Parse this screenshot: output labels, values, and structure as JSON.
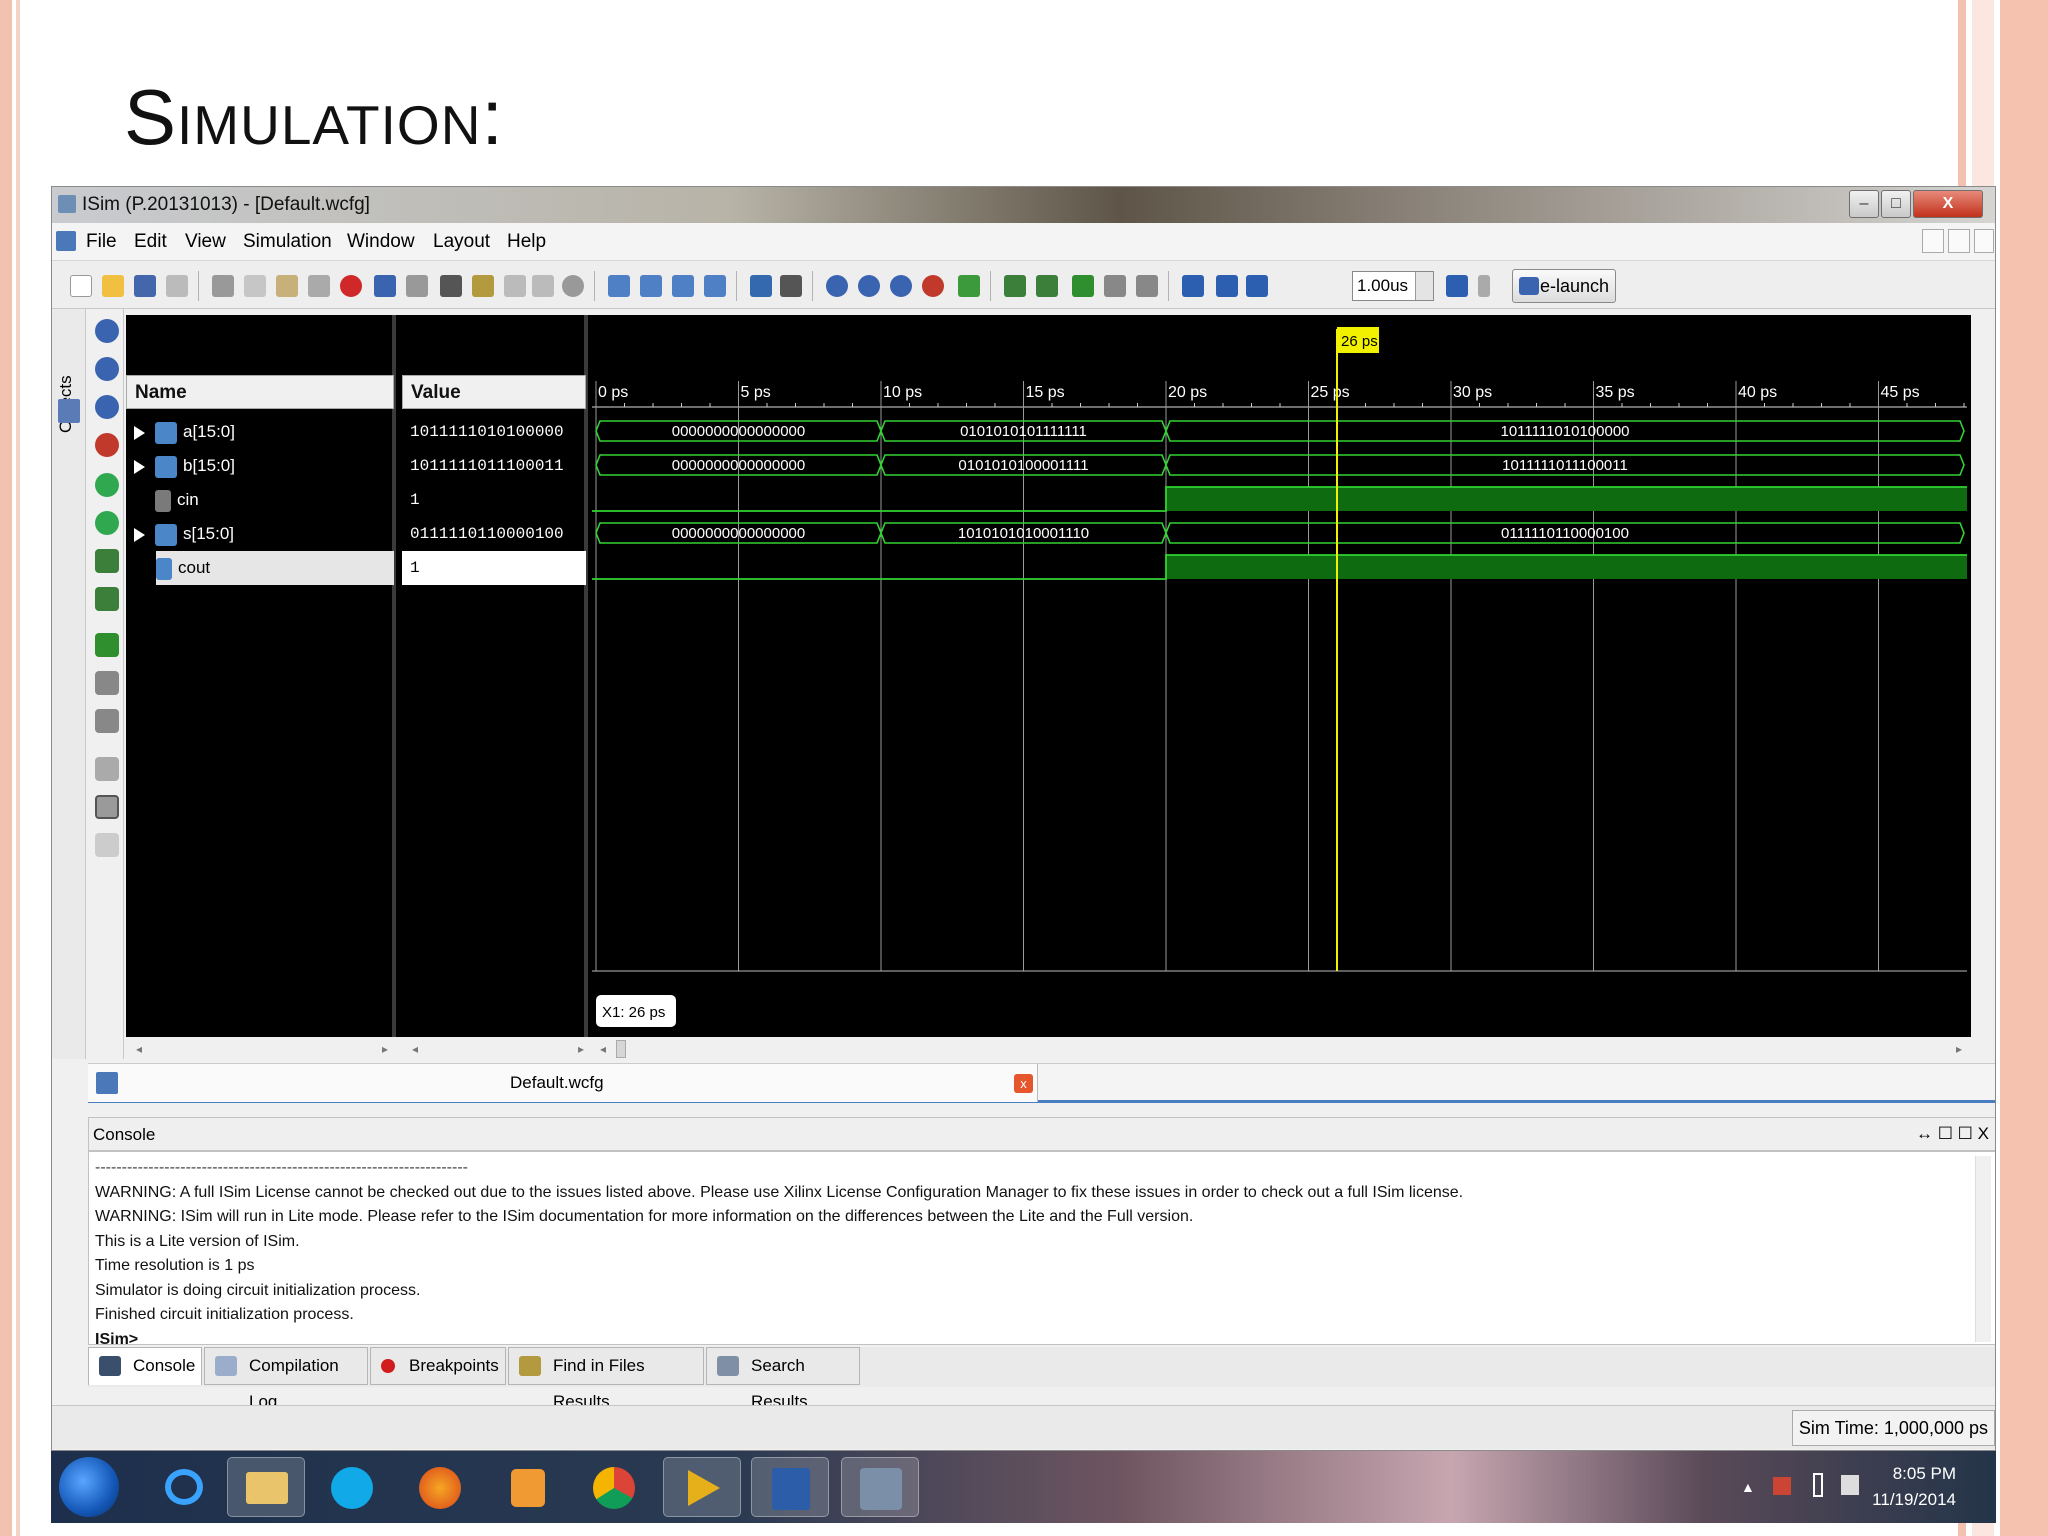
{
  "slide": {
    "title": "Simulation:"
  },
  "window": {
    "title": "ISim (P.20131013) - [Default.wcfg]",
    "menu": [
      "File",
      "Edit",
      "View",
      "Simulation",
      "Window",
      "Layout",
      "Help"
    ],
    "buttons": {
      "minimize": "–",
      "maximize": "□",
      "close": "X"
    }
  },
  "toolbar": {
    "zoom_value": "1.00us",
    "relaunch_label": "Re-launch"
  },
  "side_panel": {
    "objects_label": "Objects"
  },
  "wave": {
    "name_header": "Name",
    "value_header": "Value",
    "signals": [
      {
        "name": "a[15:0]",
        "value": "1011111010100000",
        "bus": true
      },
      {
        "name": "b[15:0]",
        "value": "1011111011100011",
        "bus": true
      },
      {
        "name": "cin",
        "value": "1",
        "bus": false
      },
      {
        "name": "s[15:0]",
        "value": "0111110110000100",
        "bus": true
      },
      {
        "name": "cout",
        "value": "1",
        "bus": false
      }
    ],
    "time_ticks": [
      "0 ps",
      "5 ps",
      "10 ps",
      "15 ps",
      "20 ps",
      "25 ps",
      "30 ps",
      "35 ps",
      "40 ps",
      "45 ps"
    ],
    "cursor_label": "26 ps",
    "cursor_time": 26,
    "cursor_readout": "X1: 26 ps",
    "bus_segments": [
      [
        {
          "start": 0,
          "end": 10,
          "label": "0000000000000000"
        },
        {
          "start": 10,
          "end": 20,
          "label": "0101010101111111"
        },
        {
          "start": 20,
          "end": 48,
          "label": "1011111010100000"
        }
      ],
      [
        {
          "start": 0,
          "end": 10,
          "label": "0000000000000000"
        },
        {
          "start": 10,
          "end": 20,
          "label": "0101010100001111"
        },
        {
          "start": 20,
          "end": 48,
          "label": "1011111011100011"
        }
      ],
      null,
      [
        {
          "start": 0,
          "end": 10,
          "label": "0000000000000000"
        },
        {
          "start": 10,
          "end": 20,
          "label": "1010101010001110"
        },
        {
          "start": 20,
          "end": 48,
          "label": "0111110110000100"
        }
      ],
      null
    ],
    "bit_transitions": {
      "cin": 20,
      "cout": 20
    }
  },
  "doc_tab": {
    "label": "Default.wcfg",
    "close": "x"
  },
  "console": {
    "title": "Console",
    "header_controls": "↔ ☐ ☐ X",
    "lines": [
      "----------------------------------------------------------------------",
      "WARNING: A full ISim License cannot be checked out due to the issues listed above. Please use Xilinx License Configuration Manager to fix these issues in order to check out a full ISim license.",
      "WARNING: ISim will run in Lite mode. Please refer to the ISim documentation for more information on the differences between the Lite and the Full version.",
      "This is a Lite version of ISim.",
      "Time resolution is 1 ps",
      "Simulator is doing circuit initialization process.",
      "Finished circuit initialization process."
    ],
    "prompt": "ISim>"
  },
  "console_tabs": [
    "Console",
    "Compilation Log",
    "Breakpoints",
    "Find in Files Results",
    "Search Results"
  ],
  "status": {
    "sim_time": "Sim Time: 1,000,000 ps"
  },
  "taskbar": {
    "time": "8:05 PM",
    "date": "11/19/2014"
  },
  "colors": {
    "wave_green": "#32d232",
    "cursor_yellow": "#f2f200",
    "high_fill": "#0f6b0f"
  }
}
